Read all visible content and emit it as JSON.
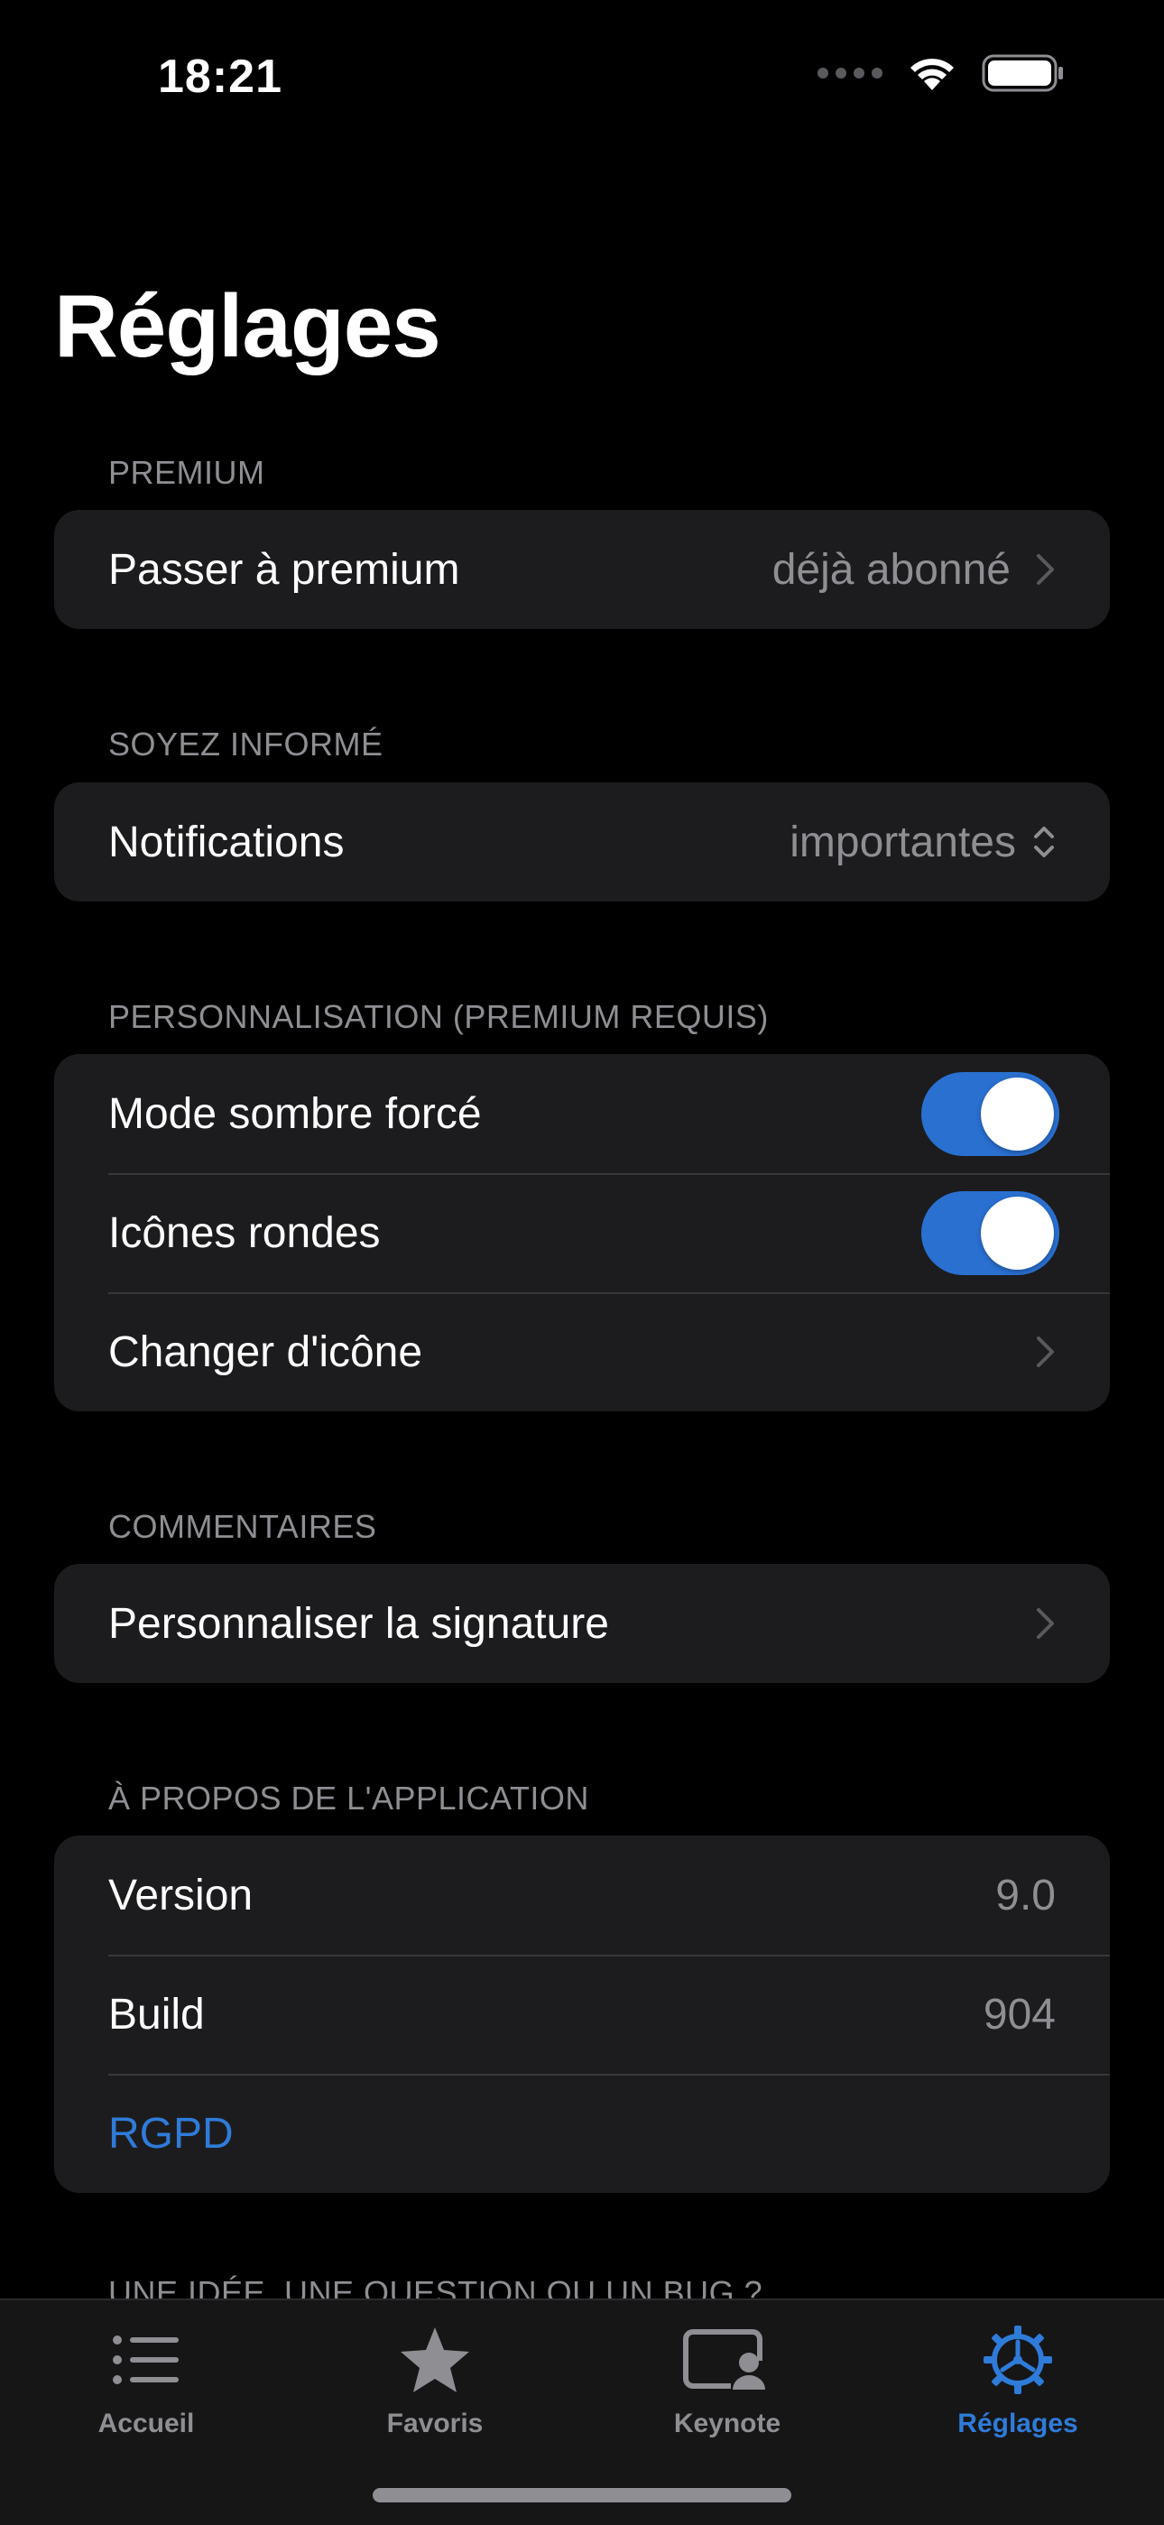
{
  "status_bar": {
    "time": "18:21"
  },
  "page": {
    "title": "Réglages"
  },
  "sections": {
    "premium": {
      "header": "PREMIUM",
      "row_label": "Passer à premium",
      "row_value": "déjà abonné"
    },
    "informe": {
      "header": "SOYEZ INFORMÉ",
      "row_label": "Notifications",
      "row_value": "importantes"
    },
    "personnalisation": {
      "header": "PERSONNALISATION (PREMIUM REQUIS)",
      "dark_mode_label": "Mode sombre forcé",
      "dark_mode_on": true,
      "round_icons_label": "Icônes rondes",
      "round_icons_on": true,
      "change_icon_label": "Changer d'icône"
    },
    "commentaires": {
      "header": "COMMENTAIRES",
      "row_label": "Personnaliser la signature"
    },
    "apropos": {
      "header": "À PROPOS DE L'APPLICATION",
      "version_label": "Version",
      "version_value": "9.0",
      "build_label": "Build",
      "build_value": "904",
      "rgpd_label": "RGPD"
    },
    "next": {
      "header": "UNE IDÉE, UNE QUESTION OU UN BUG ?"
    }
  },
  "tab_bar": {
    "tabs": [
      {
        "label": "Accueil",
        "icon": "list-icon"
      },
      {
        "label": "Favoris",
        "icon": "star-icon"
      },
      {
        "label": "Keynote",
        "icon": "keynote-icon"
      },
      {
        "label": "Réglages",
        "icon": "gear-icon",
        "active": true
      }
    ]
  },
  "colors": {
    "accent": "#2f7bd9",
    "background": "#000000",
    "cell": "#1c1c1e",
    "secondary_text": "#8e8e93",
    "toggle_on": "#2a70d1"
  }
}
